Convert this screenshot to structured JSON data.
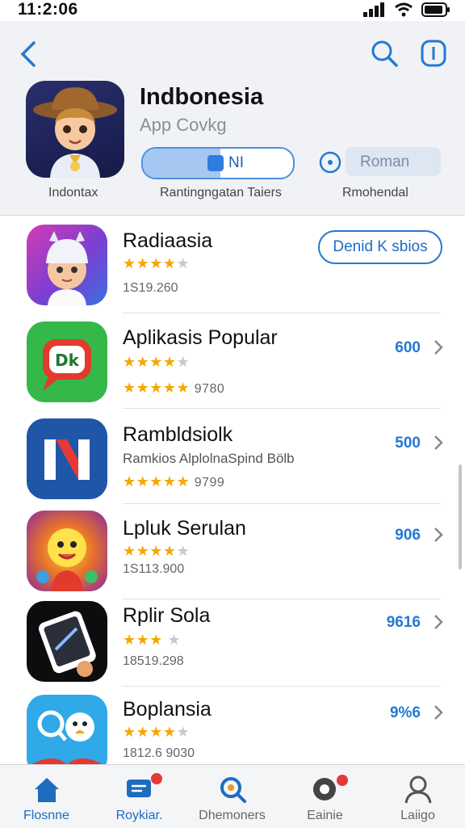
{
  "status": {
    "time": "11:2:06"
  },
  "header": {
    "title": "Indbonesia",
    "subtitle": "App Covkg",
    "toggle_label": "NI",
    "roman_label": "Roman",
    "caption_left": "Indontax",
    "caption_mid": "Rantingngatan Taiers",
    "caption_right": "Rmohendal"
  },
  "featured_button": "Denid K sbios",
  "apps": [
    {
      "name": "Radiaasia",
      "sub": "",
      "rating": 4,
      "meta": "1S19.260",
      "price": "",
      "icon": "hat-kid-icon"
    },
    {
      "name": "Aplikasis Popular",
      "sub": "",
      "rating": 4,
      "meta": "9780",
      "price": "600",
      "icon": "chat-bubble-icon"
    },
    {
      "name": "Rambldsiolk",
      "sub": "Ramkios AlplolnaSpind Bölb",
      "rating": 5,
      "meta": "9799",
      "price": "500",
      "icon": "n-logo-icon"
    },
    {
      "name": "Lpluk Serulan",
      "sub": "",
      "rating": 4,
      "meta": "1S113.900",
      "price": "906",
      "icon": "sun-face-icon"
    },
    {
      "name": "Rplir Sola",
      "sub": "",
      "rating": 3,
      "meta": "18519.298",
      "price": "9616",
      "icon": "phone-screen-icon"
    },
    {
      "name": "Boplansia",
      "sub": "",
      "rating": 4,
      "meta": "1812.6 9030",
      "price": "9%6",
      "icon": "cartoon-face-icon"
    }
  ],
  "tabs": [
    {
      "label": "Flosnne",
      "icon": "home-icon",
      "active": true
    },
    {
      "label": "Roykiar.",
      "icon": "message-icon",
      "active": false
    },
    {
      "label": "Dhemoners",
      "icon": "search-icon",
      "active": false
    },
    {
      "label": "Eainie",
      "icon": "chat-icon",
      "active": false
    },
    {
      "label": "Laiigo",
      "icon": "profile-icon",
      "active": false
    }
  ],
  "colors": {
    "accent": "#2479d1",
    "star": "#f4a800",
    "badge": "#e53935"
  }
}
